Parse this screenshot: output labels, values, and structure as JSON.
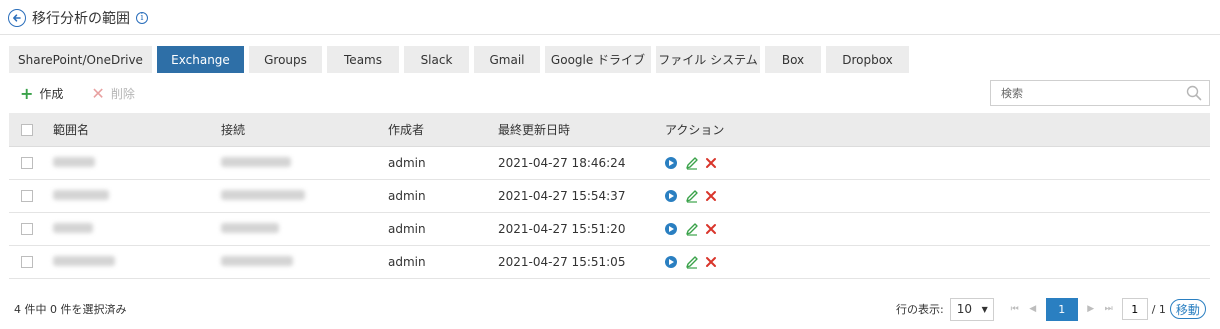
{
  "header": {
    "title": "移行分析の範囲"
  },
  "tabs": [
    {
      "label": "SharePoint/OneDrive",
      "active": false
    },
    {
      "label": "Exchange",
      "active": true
    },
    {
      "label": "Groups",
      "active": false
    },
    {
      "label": "Teams",
      "active": false
    },
    {
      "label": "Slack",
      "active": false
    },
    {
      "label": "Gmail",
      "active": false
    },
    {
      "label": "Google ドライブ",
      "active": false
    },
    {
      "label": "ファイル システム",
      "active": false
    },
    {
      "label": "Box",
      "active": false
    },
    {
      "label": "Dropbox",
      "active": false
    }
  ],
  "toolbar": {
    "create_label": "作成",
    "delete_label": "削除"
  },
  "search": {
    "placeholder": "検索"
  },
  "table": {
    "headers": {
      "name": "範囲名",
      "connection": "接続",
      "creator": "作成者",
      "updated": "最終更新日時",
      "actions": "アクション"
    },
    "rows": [
      {
        "creator": "admin",
        "updated": "2021-04-27 18:46:24"
      },
      {
        "creator": "admin",
        "updated": "2021-04-27 15:54:37"
      },
      {
        "creator": "admin",
        "updated": "2021-04-27 15:51:20"
      },
      {
        "creator": "admin",
        "updated": "2021-04-27 15:51:05"
      }
    ]
  },
  "footer": {
    "selection_text": "4 件中 0 件を選択済み",
    "rows_label": "行の表示:",
    "rows_per_page": "10",
    "current_page": "1",
    "page_input": "1",
    "total_pages": "/ 1",
    "go_label": "移動"
  },
  "colors": {
    "accent": "#2e6fa7",
    "create": "#3aa24a",
    "delete": "#d9352b",
    "run": "#2a7fc1"
  }
}
